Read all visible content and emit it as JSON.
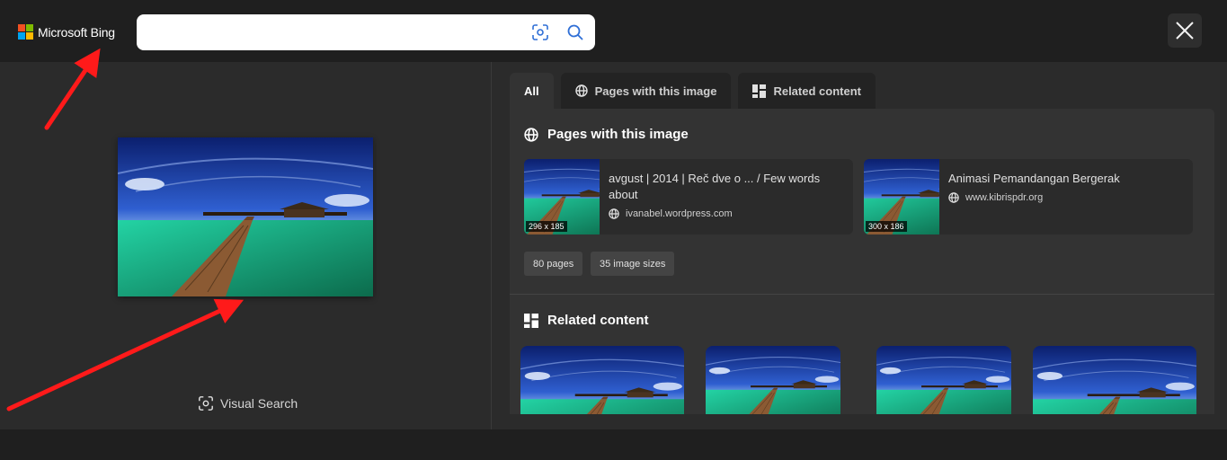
{
  "header": {
    "logo_text": "Microsoft Bing",
    "search": {
      "value": "",
      "placeholder": ""
    },
    "visual_search_icon": "camera-scan-icon",
    "search_icon": "magnifier-icon",
    "close_icon": "close-icon"
  },
  "left_panel": {
    "visual_search_label": "Visual Search"
  },
  "tabs": [
    {
      "label": "All",
      "icon": ""
    },
    {
      "label": "Pages with this image",
      "icon": "globe-icon"
    },
    {
      "label": "Related content",
      "icon": "grid-icon"
    }
  ],
  "pages_section": {
    "title": "Pages with this image",
    "cards": [
      {
        "title": "avgust | 2014 | Reč dve o ... / Few words about",
        "site": "ivanabel.wordpress.com",
        "dimensions": "296 x 185"
      },
      {
        "title": "Animasi Pemandangan Bergerak",
        "site": "www.kibrispdr.org",
        "dimensions": "300 x 186"
      }
    ],
    "chips": [
      "80 pages",
      "35 image sizes"
    ]
  },
  "related_section": {
    "title": "Related content"
  },
  "colors": {
    "background": "#1f1f1f",
    "panel": "#2b2b2b",
    "annotation_arrow": "#ff1a1a",
    "ms_red": "#f25022",
    "ms_green": "#7fba00",
    "ms_blue": "#00a4ef",
    "ms_yellow": "#ffb900"
  }
}
